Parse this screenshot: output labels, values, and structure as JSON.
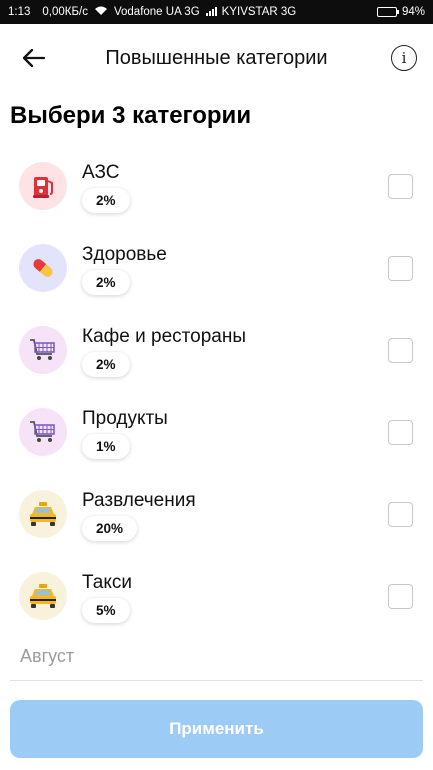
{
  "status_bar": {
    "time": "1:13",
    "speed": "0,00КБ/с",
    "carrier1": "Vodafone UA 3G",
    "carrier2": "KYIVSTAR 3G",
    "battery": "94%",
    "battery_level": 0.94
  },
  "header": {
    "title": "Повышенные категории",
    "back_icon": "arrow-left-icon",
    "info_icon": "info-icon",
    "info_glyph": "i"
  },
  "heading": "Выбери 3 категории",
  "categories": [
    {
      "label": "АЗС",
      "percent": "2%",
      "icon": "fuel-pump-icon",
      "icon_bg": "#fde3e6",
      "checked": false
    },
    {
      "label": "Здоровье",
      "percent": "2%",
      "icon": "pill-icon",
      "icon_bg": "#e3e4fb",
      "checked": false
    },
    {
      "label": "Кафе и рестораны",
      "percent": "2%",
      "icon": "shopping-cart-icon",
      "icon_bg": "#f6e3f7",
      "checked": false
    },
    {
      "label": "Продукты",
      "percent": "1%",
      "icon": "shopping-cart-icon",
      "icon_bg": "#f6e3f7",
      "checked": false
    },
    {
      "label": "Развлечения",
      "percent": "20%",
      "icon": "taxi-icon",
      "icon_bg": "#f8f1dc",
      "checked": false
    },
    {
      "label": "Такси",
      "percent": "5%",
      "icon": "taxi-icon",
      "icon_bg": "#f8f1dc",
      "checked": false
    }
  ],
  "month": "Август",
  "apply_button": "Применить",
  "colors": {
    "apply_bg": "#9ccbf6",
    "checkbox_border": "#c8c8c8"
  }
}
